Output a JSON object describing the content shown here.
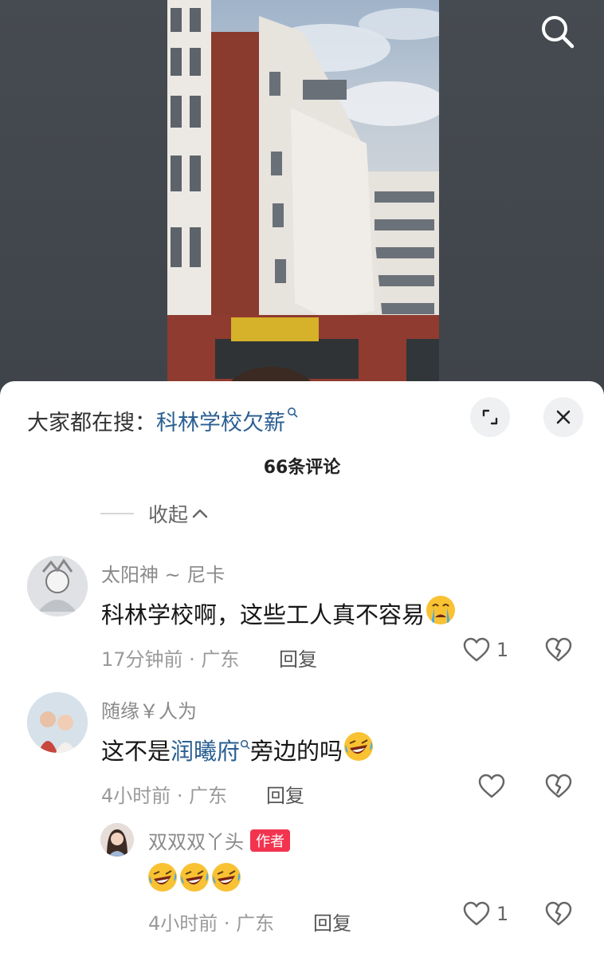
{
  "hot_search": {
    "prefix": "大家都在搜：",
    "keyword": "科林学校欠薪"
  },
  "comment_count": "66条评论",
  "collapse_label": "收起",
  "comments": [
    {
      "user": "太阳神 ~ 尼卡",
      "text": "科林学校啊，这些工人真不容易",
      "emoji": [
        "crying-face"
      ],
      "time": "17分钟前 · 广东",
      "reply": "回复",
      "likes": "1"
    },
    {
      "user": "随缘￥人为",
      "text_before": "这不是",
      "link": "润曦府",
      "text_after": "旁边的吗",
      "emoji": [
        "laughing-crying-face"
      ],
      "time": "4小时前 · 广东",
      "reply": "回复",
      "likes": ""
    },
    {
      "user": "双双双丫头",
      "badge": "作者",
      "emoji": [
        "laughing-crying-face",
        "laughing-crying-face",
        "laughing-crying-face"
      ],
      "time": "4小时前 · 广东",
      "reply": "回复",
      "likes": "1"
    }
  ],
  "colors": {
    "link": "#2b5f92",
    "author_badge": "#f2344f"
  },
  "icons": [
    "search-icon",
    "expand-icon",
    "close-icon",
    "heart-icon",
    "broken-heart-icon",
    "chevron-up-icon"
  ]
}
